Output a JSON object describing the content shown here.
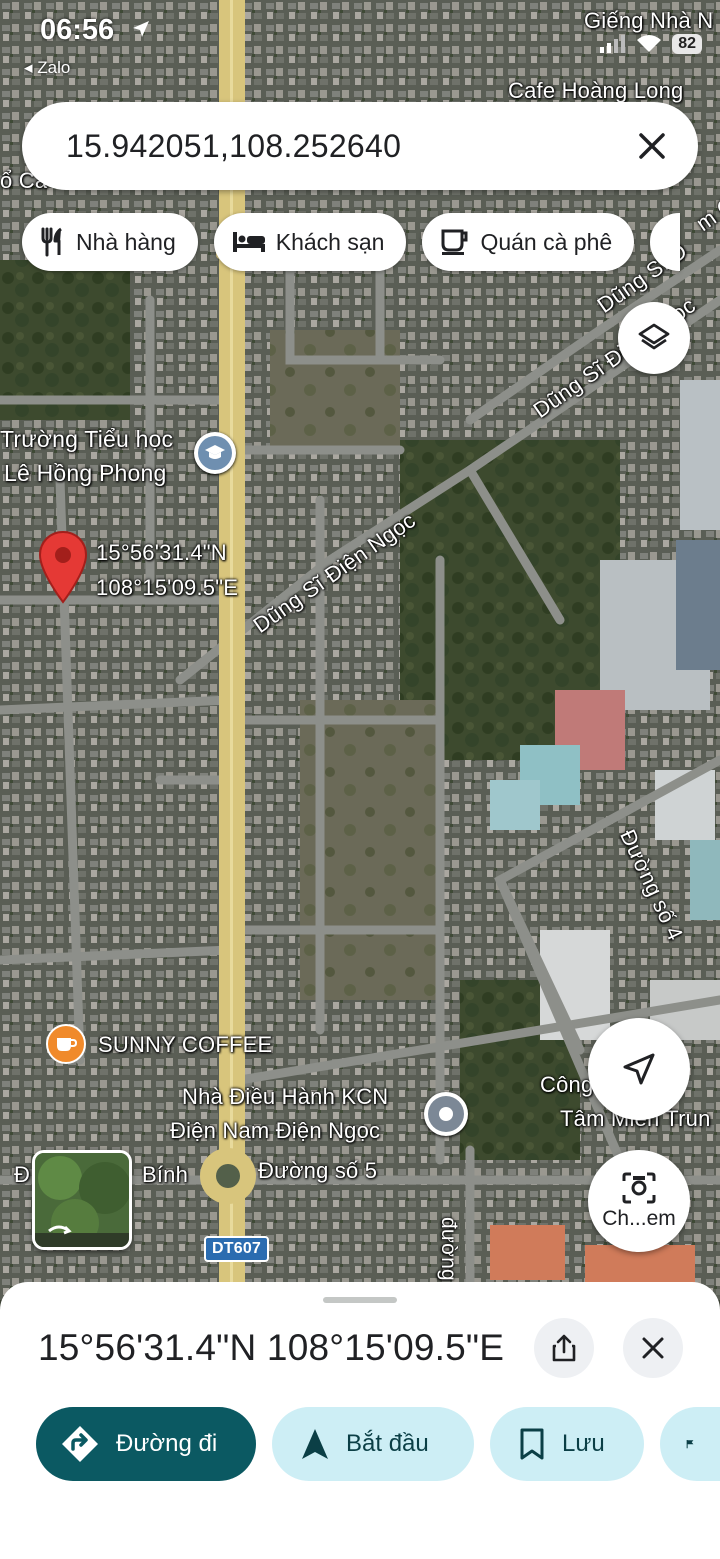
{
  "status_bar": {
    "time": "06:56",
    "back_app": "◂ Zalo",
    "battery": "82"
  },
  "search": {
    "query": "15.942051,108.252640"
  },
  "chips": [
    {
      "label": "Nhà hàng",
      "icon": "restaurant-icon"
    },
    {
      "label": "Khách sạn",
      "icon": "hotel-icon"
    },
    {
      "label": "Quán cà phê",
      "icon": "coffee-icon"
    }
  ],
  "map": {
    "labels": {
      "gieng_nha": "Giếng Nhà N",
      "cafe_hoang_long": "Cafe Hoàng Long",
      "co_ca": "ổ Ca",
      "school": "Trường Tiểu học",
      "school2": "Lê Hồng Phong",
      "pin_lat": "15°56'31.4\"N",
      "pin_lng": "108°15'09.5\"E",
      "road_dung_si_1": "Dũng Sĩ Điện Ngọc",
      "road_dung_si_2": "Dũng Sĩ Điện Ngọc",
      "road_dung_si_3": "Dũng Sĩ Đ",
      "road_so4": "Đường số 4",
      "road_so5": "Đường số 5",
      "road_duong": "đường",
      "sunny": "SUNNY COFFEE",
      "kcn1": "Nhà Điều Hành KCN",
      "kcn2": "Điện Nam Điện Ngọc",
      "cong_ty1": "Công",
      "cong_ty2": "Tâm Miền Trun",
      "dt_top": "DT",
      "dt607": "DT607",
      "binh": "Bính",
      "ca_right": "m Ca",
      "d_left": "Đ"
    },
    "colors": {
      "main_road": "#d9c77a",
      "road": "#8a8c86",
      "pin": "#e53935"
    }
  },
  "camera": {
    "label": "Ch...em"
  },
  "place_sheet": {
    "title": "15°56'31.4\"N 108°15'09.5\"E",
    "actions": {
      "directions": "Đường đi",
      "start": "Bắt đầu",
      "save": "Lưu"
    },
    "accent": "#0b5962",
    "tonal": "#cdeef5"
  }
}
